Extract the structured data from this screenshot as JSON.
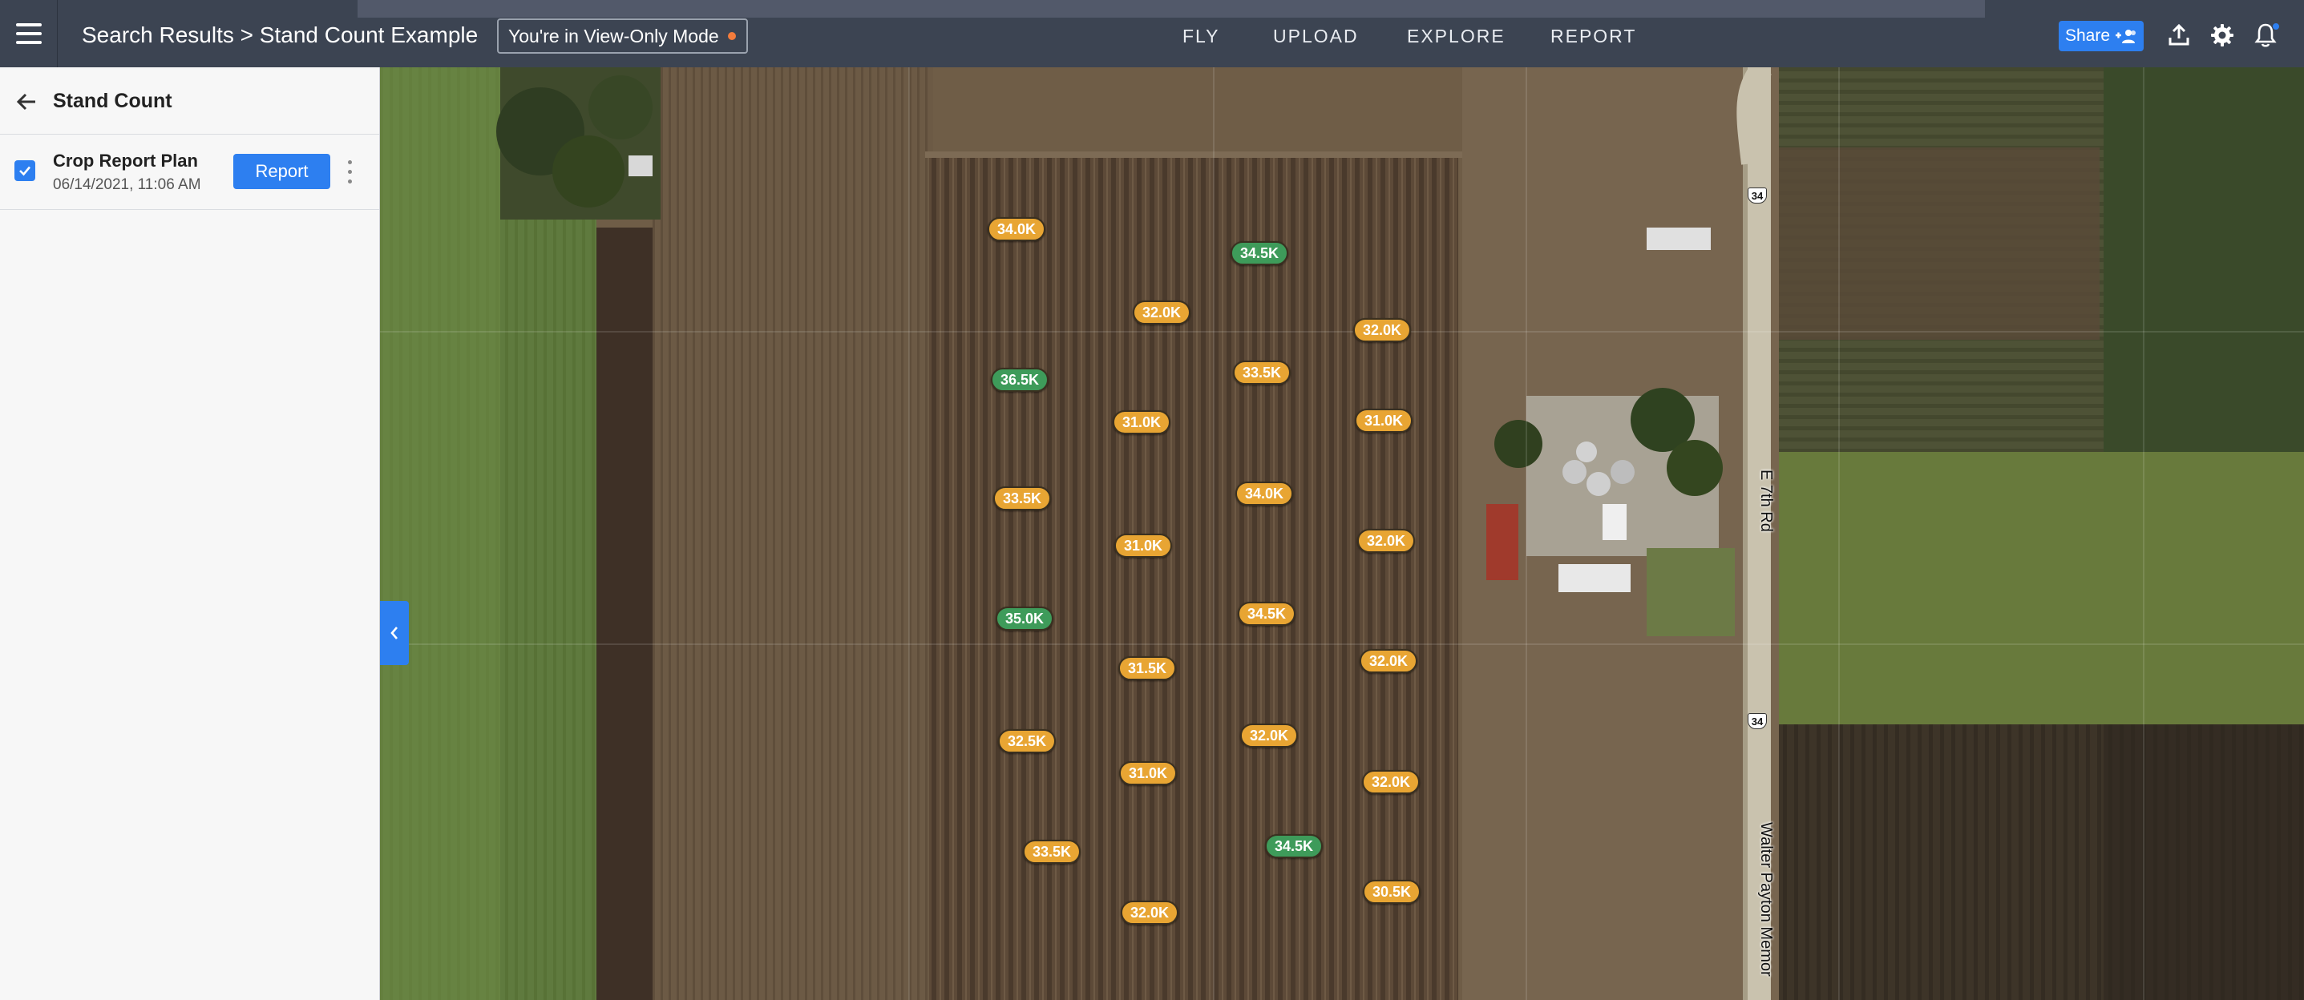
{
  "header": {
    "breadcrumb_parent": "Search Results",
    "breadcrumb_sep": ">",
    "breadcrumb_current": "Stand Count Example",
    "view_only": "You're in View-Only Mode",
    "nav": [
      "FLY",
      "UPLOAD",
      "EXPLORE",
      "REPORT"
    ],
    "share_label": "Share"
  },
  "sidebar": {
    "title": "Stand Count",
    "plan": {
      "name": "Crop Report Plan",
      "date": "06/14/2021, 11:06 AM",
      "checked": true,
      "report_label": "Report"
    }
  },
  "map": {
    "road_name_1": "E 7th Rd",
    "road_name_2": "Walter Payton Memor",
    "route_shield_1": "34",
    "route_shield_2": "34",
    "colors": {
      "orange": "#e8a533",
      "green": "#3e9b5a"
    },
    "stand_counts": [
      {
        "value": "34.0K",
        "color": "orange"
      },
      {
        "value": "34.5K",
        "color": "green"
      },
      {
        "value": "32.0K",
        "color": "orange"
      },
      {
        "value": "32.0K",
        "color": "orange"
      },
      {
        "value": "36.5K",
        "color": "green"
      },
      {
        "value": "33.5K",
        "color": "orange"
      },
      {
        "value": "31.0K",
        "color": "orange"
      },
      {
        "value": "31.0K",
        "color": "orange"
      },
      {
        "value": "33.5K",
        "color": "orange"
      },
      {
        "value": "34.0K",
        "color": "orange"
      },
      {
        "value": "31.0K",
        "color": "orange"
      },
      {
        "value": "32.0K",
        "color": "orange"
      },
      {
        "value": "35.0K",
        "color": "green"
      },
      {
        "value": "34.5K",
        "color": "orange"
      },
      {
        "value": "31.5K",
        "color": "orange"
      },
      {
        "value": "32.0K",
        "color": "orange"
      },
      {
        "value": "32.5K",
        "color": "orange"
      },
      {
        "value": "32.0K",
        "color": "orange"
      },
      {
        "value": "31.0K",
        "color": "orange"
      },
      {
        "value": "32.0K",
        "color": "orange"
      },
      {
        "value": "33.5K",
        "color": "orange"
      },
      {
        "value": "34.5K",
        "color": "green"
      },
      {
        "value": "30.5K",
        "color": "orange"
      },
      {
        "value": "32.0K",
        "color": "orange"
      }
    ]
  }
}
